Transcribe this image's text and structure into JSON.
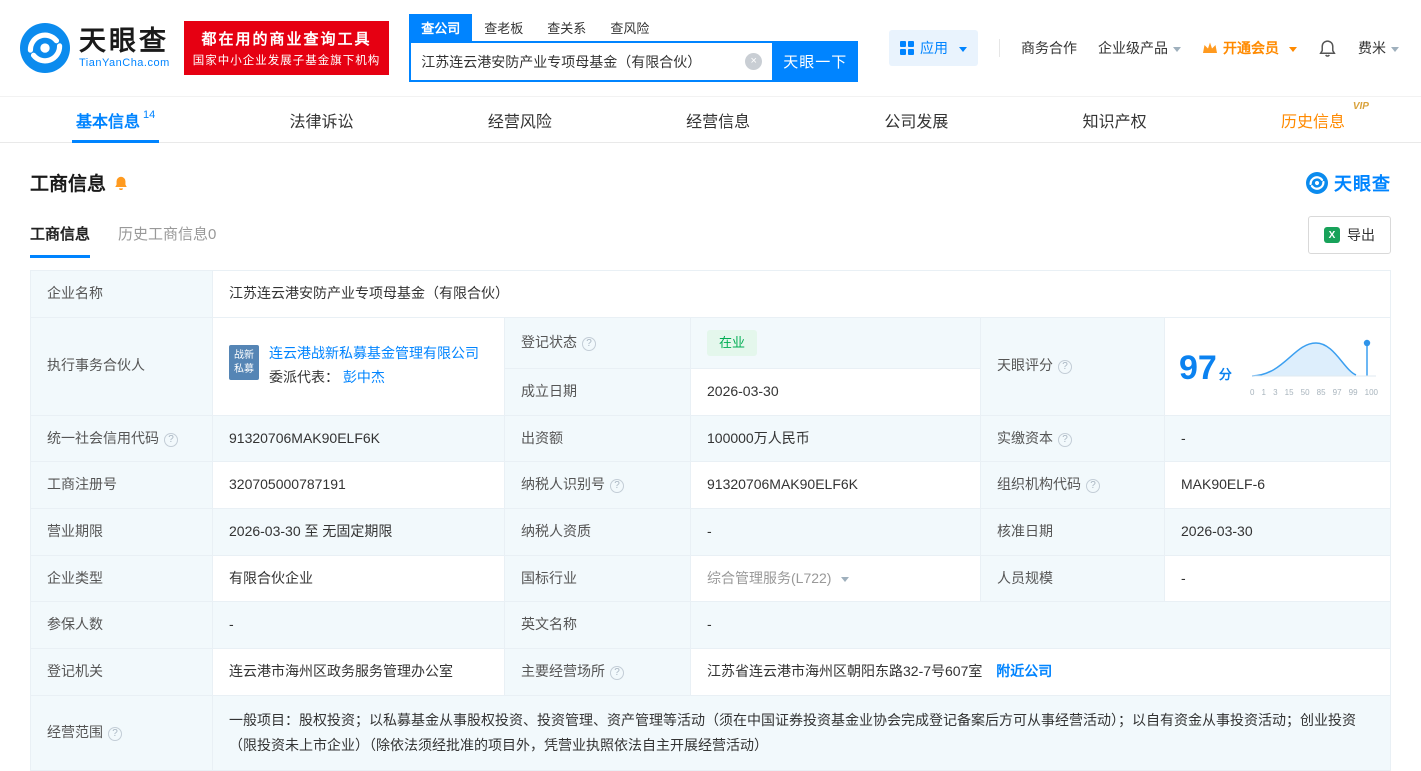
{
  "brand": {
    "name": "天眼查",
    "domain": "TianYanCha.com"
  },
  "promo": {
    "line1": "都在用的商业查询工具",
    "line2": "国家中小企业发展子基金旗下机构"
  },
  "search": {
    "tabs": [
      {
        "label": "查公司",
        "active": true
      },
      {
        "label": "查老板",
        "active": false
      },
      {
        "label": "查关系",
        "active": false
      },
      {
        "label": "查风险",
        "active": false
      }
    ],
    "value": "江苏连云港安防产业专项母基金（有限合伙）",
    "button_label": "天眼一下"
  },
  "topnav": {
    "apps_label": "应用",
    "coop_label": "商务合作",
    "enterprise_label": "企业级产品",
    "vip_label": "开通会员",
    "user_label": "费米"
  },
  "tabs": [
    {
      "label": "基本信息",
      "count": "14",
      "active": true
    },
    {
      "label": "法律诉讼"
    },
    {
      "label": "经营风险"
    },
    {
      "label": "经营信息"
    },
    {
      "label": "公司发展"
    },
    {
      "label": "知识产权"
    },
    {
      "label": "历史信息",
      "vip": "VIP"
    }
  ],
  "section": {
    "title": "工商信息",
    "brand_mark": "天眼查",
    "subtabs": [
      "工商信息",
      "历史工商信息0"
    ],
    "export_label": "导出"
  },
  "icons": {
    "help": "?",
    "clear": "×",
    "excel": "X"
  },
  "biz": {
    "name": {
      "label": "企业名称",
      "value": "江苏连云港安防产业专项母基金（有限合伙）"
    },
    "partner": {
      "label": "执行事务合伙人",
      "badge_line1": "战新",
      "badge_line2": "私募",
      "company": "连云港战新私募基金管理有限公司",
      "delegate_label": "委派代表：",
      "delegate": "彭中杰"
    },
    "status": {
      "label": "登记状态",
      "value": "在业"
    },
    "established": {
      "label": "成立日期",
      "value": "2026-03-30"
    },
    "score": {
      "label": "天眼评分",
      "value": "97",
      "unit": "分",
      "axis": [
        "0",
        "1",
        "3",
        "15",
        "50",
        "85",
        "97",
        "99",
        "100"
      ]
    },
    "credit_code": {
      "label": "统一社会信用代码",
      "value": "91320706MAK90ELF6K"
    },
    "capital": {
      "label": "出资额",
      "value": "100000万人民币"
    },
    "paid_capital": {
      "label": "实缴资本",
      "value": "-"
    },
    "reg_number": {
      "label": "工商注册号",
      "value": "320705000787191"
    },
    "taxpayer_id": {
      "label": "纳税人识别号",
      "value": "91320706MAK90ELF6K"
    },
    "org_code": {
      "label": "组织机构代码",
      "value": "MAK90ELF-6"
    },
    "term": {
      "label": "营业期限",
      "value": "2026-03-30 至 无固定期限"
    },
    "taxpayer_quality": {
      "label": "纳税人资质",
      "value": "-"
    },
    "approval_date": {
      "label": "核准日期",
      "value": "2026-03-30"
    },
    "company_type": {
      "label": "企业类型",
      "value": "有限合伙企业"
    },
    "industry": {
      "label": "国标行业",
      "value": "综合管理服务(L722)"
    },
    "staff_size": {
      "label": "人员规模",
      "value": "-"
    },
    "insured": {
      "label": "参保人数",
      "value": "-"
    },
    "english_name": {
      "label": "英文名称",
      "value": "-"
    },
    "registry": {
      "label": "登记机关",
      "value": "连云港市海州区政务服务管理办公室"
    },
    "premises": {
      "label": "主要经营场所",
      "value": "江苏省连云港市海州区朝阳东路32-7号607室",
      "link": "附近公司"
    },
    "scope": {
      "label": "经营范围",
      "value": "一般项目：股权投资；以私募基金从事股权投资、投资管理、资产管理等活动（须在中国证券投资基金业协会完成登记备案后方可从事经营活动）；以自有资金从事投资活动；创业投资（限投资未上市企业）（除依法须经批准的项目外，凭营业执照依法自主开展经营活动）"
    }
  }
}
